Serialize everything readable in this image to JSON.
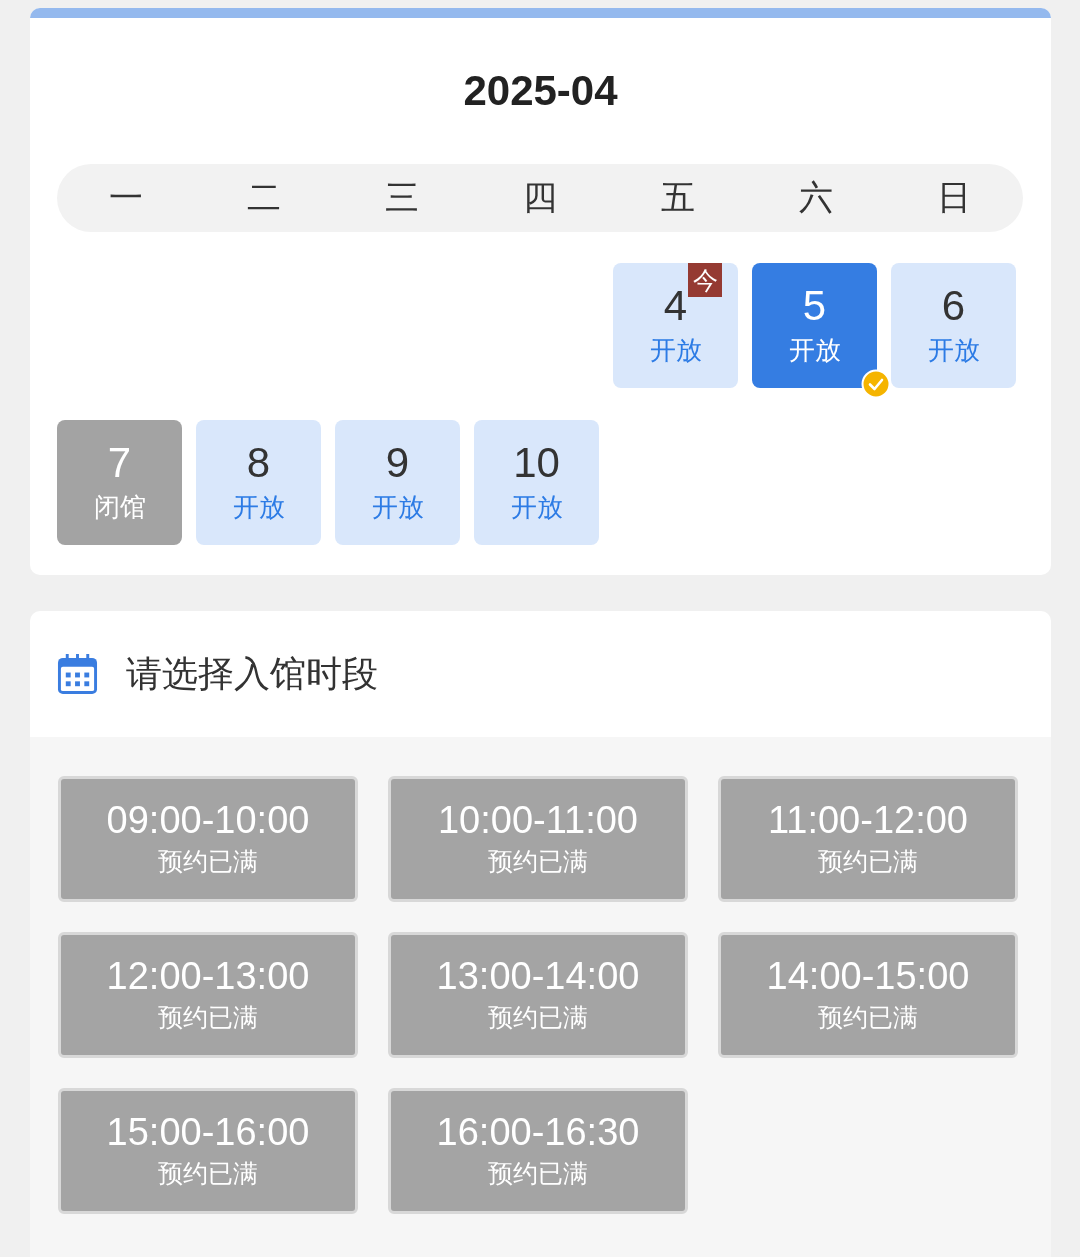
{
  "calendar": {
    "month": "2025-04",
    "weekdays": [
      "一",
      "二",
      "三",
      "四",
      "五",
      "六",
      "日"
    ],
    "days": [
      {
        "day": "4",
        "status": "开放",
        "kind": "open",
        "selected": false,
        "today_badge": "今"
      },
      {
        "day": "5",
        "status": "开放",
        "kind": "open",
        "selected": true
      },
      {
        "day": "6",
        "status": "开放",
        "kind": "open",
        "selected": false
      },
      {
        "day": "7",
        "status": "闭馆",
        "kind": "closed",
        "selected": false
      },
      {
        "day": "8",
        "status": "开放",
        "kind": "open",
        "selected": false
      },
      {
        "day": "9",
        "status": "开放",
        "kind": "open",
        "selected": false
      },
      {
        "day": "10",
        "status": "开放",
        "kind": "open",
        "selected": false
      }
    ]
  },
  "time_slots": {
    "title": "请选择入馆时段",
    "slots": [
      {
        "time": "09:00-10:00",
        "status": "预约已满",
        "kind": "full"
      },
      {
        "time": "10:00-11:00",
        "status": "预约已满",
        "kind": "full"
      },
      {
        "time": "11:00-12:00",
        "status": "预约已满",
        "kind": "full"
      },
      {
        "time": "12:00-13:00",
        "status": "预约已满",
        "kind": "full"
      },
      {
        "time": "13:00-14:00",
        "status": "预约已满",
        "kind": "full"
      },
      {
        "time": "14:00-15:00",
        "status": "预约已满",
        "kind": "full"
      },
      {
        "time": "15:00-16:00",
        "status": "预约已满",
        "kind": "full"
      },
      {
        "time": "16:00-16:30",
        "status": "预约已满",
        "kind": "full"
      }
    ]
  }
}
